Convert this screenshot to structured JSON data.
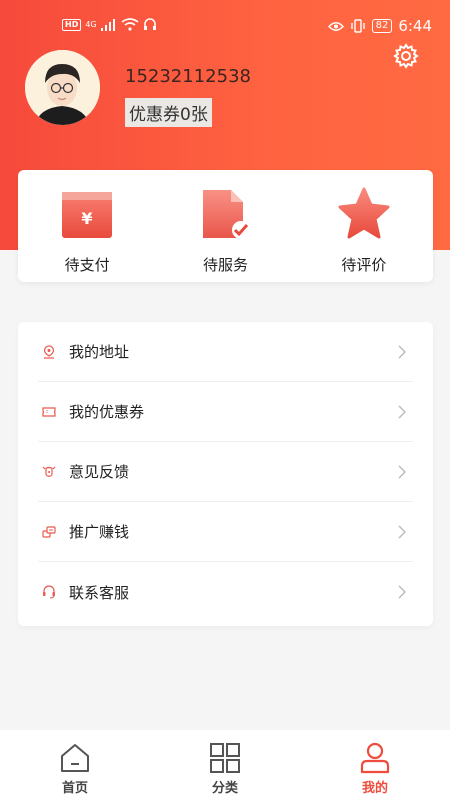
{
  "status_bar": {
    "hd_badge": "HD",
    "network": "4G",
    "battery": "82",
    "time": "6:44"
  },
  "profile": {
    "phone": "15232112538",
    "coupon_text": "优惠券0张"
  },
  "orders": [
    {
      "label": "待支付",
      "icon": "wallet-yen-icon"
    },
    {
      "label": "待服务",
      "icon": "document-check-icon"
    },
    {
      "label": "待评价",
      "icon": "star-icon"
    }
  ],
  "menu": [
    {
      "label": "我的地址",
      "icon": "location-pin-icon"
    },
    {
      "label": "我的优惠券",
      "icon": "ticket-icon"
    },
    {
      "label": "意见反馈",
      "icon": "feedback-icon"
    },
    {
      "label": "推广赚钱",
      "icon": "coins-icon"
    },
    {
      "label": "联系客服",
      "icon": "headset-icon"
    }
  ],
  "tabs": [
    {
      "label": "首页",
      "icon": "home-icon"
    },
    {
      "label": "分类",
      "icon": "grid-icon"
    },
    {
      "label": "我的",
      "icon": "user-icon",
      "active": true
    }
  ],
  "colors": {
    "brand": "#f64a3c",
    "brand_light": "#ff6a42",
    "active_tab": "#ee4c3c"
  }
}
